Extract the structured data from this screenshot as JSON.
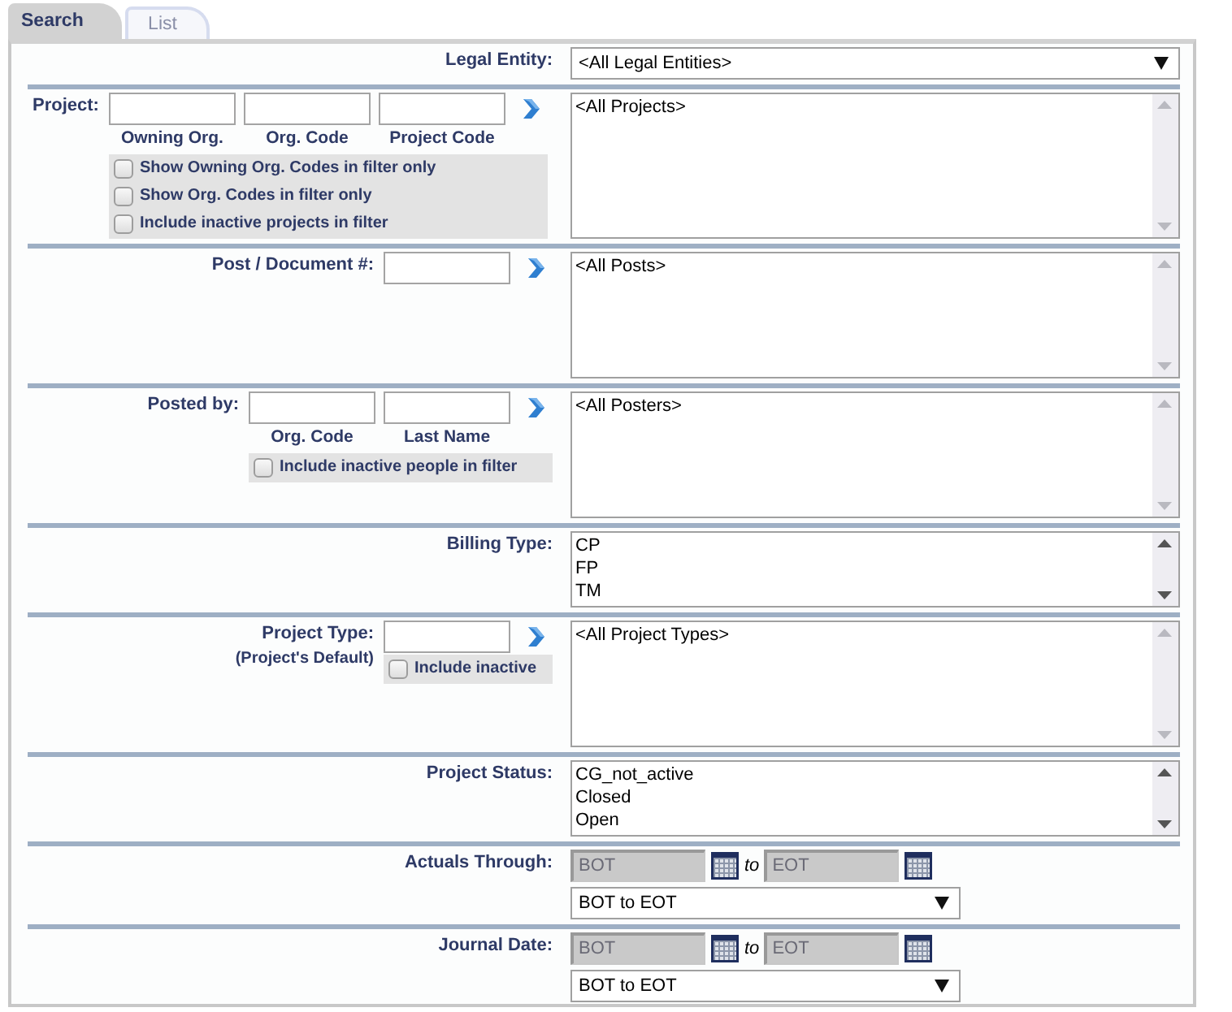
{
  "tabs": [
    {
      "label": "Search",
      "selected": true
    },
    {
      "label": "List",
      "selected": false
    }
  ],
  "rows": [
    {
      "kind": "simple",
      "label": "Legal Entity:",
      "control": {
        "kind": "dropdown",
        "value": "<All Legal Entities>"
      }
    },
    {
      "kind": "wide_filter",
      "label": "Project:",
      "fields": [
        {
          "kind": "input",
          "caption": "Owning Org."
        },
        {
          "kind": "input",
          "caption": "Org. Code"
        },
        {
          "kind": "input",
          "caption": "Project Code"
        }
      ],
      "go_button": true,
      "checkboxes": [
        {
          "label": "Show Owning Org. Codes in filter only",
          "checked": false
        },
        {
          "label": "Show Org. Codes in filter only",
          "checked": false
        },
        {
          "label": "Include inactive projects in filter",
          "checked": false
        }
      ],
      "control": {
        "kind": "listbox",
        "options": [
          "<All Projects>"
        ]
      }
    },
    {
      "kind": "filter",
      "label": "Post / Document #:",
      "fields": [
        {
          "kind": "input"
        }
      ],
      "go_button": true,
      "control": {
        "kind": "listbox",
        "options": [
          "<All Posts>"
        ]
      }
    },
    {
      "kind": "filter",
      "label": "Posted by:",
      "fields": [
        {
          "kind": "input",
          "caption": "Org. Code"
        },
        {
          "kind": "input",
          "caption": "Last Name"
        }
      ],
      "go_button": true,
      "checkboxes": [
        {
          "label": "Include inactive people in filter",
          "checked": false
        }
      ],
      "control": {
        "kind": "listbox",
        "options": [
          "<All Posters>"
        ]
      }
    },
    {
      "kind": "simple",
      "label": "Billing Type:",
      "control": {
        "kind": "listbox",
        "options": [
          "CP",
          "FP",
          "TM"
        ]
      }
    },
    {
      "kind": "filter",
      "label": "Project Type:",
      "sublabel": "(Project's Default)",
      "fields": [
        {
          "kind": "input"
        }
      ],
      "go_button": true,
      "checkboxes": [
        {
          "label": "Include inactive",
          "checked": false
        }
      ],
      "control": {
        "kind": "listbox",
        "options": [
          "<All Project Types>"
        ]
      }
    },
    {
      "kind": "simple",
      "label": "Project Status:",
      "control": {
        "kind": "listbox",
        "options": [
          "CG_not_active",
          "Closed",
          "Open"
        ]
      }
    },
    {
      "kind": "simple",
      "label": "Actuals Through:",
      "control": {
        "kind": "daterange",
        "from": "BOT",
        "to_label": "to",
        "to": "EOT",
        "disabled": true,
        "preset": "BOT to EOT"
      }
    },
    {
      "kind": "simple",
      "label": "Journal Date:",
      "control": {
        "kind": "daterange",
        "from": "BOT",
        "to_label": "to",
        "to": "EOT",
        "disabled": true,
        "preset": "BOT to EOT"
      }
    }
  ]
}
